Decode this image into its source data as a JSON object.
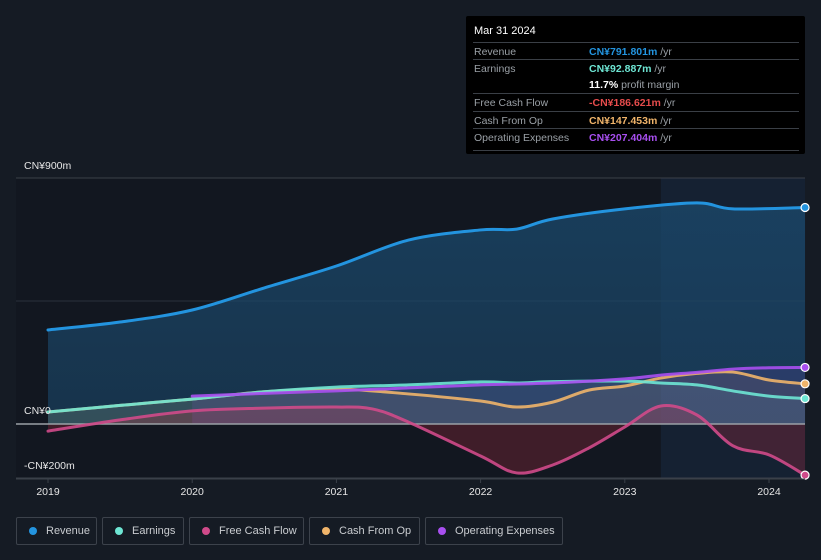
{
  "tooltip": {
    "date": "Mar 31 2024",
    "rows": [
      {
        "label": "Revenue",
        "value": "CN¥791.801m",
        "unit": " /yr",
        "color": "#2394df"
      },
      {
        "label": "Earnings",
        "value": "CN¥92.887m",
        "unit": " /yr",
        "color": "#6ee6d4"
      },
      {
        "label": "",
        "value": "11.7%",
        "unit": " profit margin",
        "color": "#ffffff"
      },
      {
        "label": "Free Cash Flow",
        "value": "-CN¥186.621m",
        "unit": " /yr",
        "color": "#e64c4c"
      },
      {
        "label": "Cash From Op",
        "value": "CN¥147.453m",
        "unit": " /yr",
        "color": "#f0b46a"
      },
      {
        "label": "Operating Expenses",
        "value": "CN¥207.404m",
        "unit": " /yr",
        "color": "#a84ff0"
      }
    ]
  },
  "legend": [
    {
      "label": "Revenue",
      "color": "#2394df"
    },
    {
      "label": "Earnings",
      "color": "#6ee6d4"
    },
    {
      "label": "Free Cash Flow",
      "color": "#d04a8a"
    },
    {
      "label": "Cash From Op",
      "color": "#f0b46a"
    },
    {
      "label": "Operating Expenses",
      "color": "#a84ff0"
    }
  ],
  "chart_data": {
    "type": "area",
    "title": "",
    "xlabel": "",
    "ylabel": "",
    "ylim": [
      -200,
      900
    ],
    "xlim": [
      2018.78,
      2024.25
    ],
    "y_tick_labels": [
      {
        "value": 900,
        "label": "CN¥900m"
      },
      {
        "value": 0,
        "label": "CN¥0"
      },
      {
        "value": -200,
        "label": "-CN¥200m"
      }
    ],
    "x_ticks": [
      2019,
      2020,
      2021,
      2022,
      2023,
      2024
    ],
    "x_tick_labels": [
      "2019",
      "2020",
      "2021",
      "2022",
      "2023",
      "2024"
    ],
    "grid": true,
    "highlight_from": 2023.25,
    "legend_position": "bottom-left",
    "series": [
      {
        "name": "Revenue",
        "color": "#2394df",
        "x": [
          2019,
          2019.5,
          2020,
          2020.5,
          2021,
          2021.5,
          2022,
          2022.25,
          2022.5,
          2023,
          2023.5,
          2023.75,
          2024.25
        ],
        "values": [
          344,
          373,
          417,
          498,
          578,
          673,
          710,
          713,
          750,
          787,
          809,
          787,
          792
        ]
      },
      {
        "name": "Earnings",
        "color": "#6ee6d4",
        "x": [
          2019,
          2019.5,
          2020,
          2020.5,
          2021,
          2021.5,
          2022,
          2022.25,
          2022.5,
          2023,
          2023.25,
          2023.5,
          2023.75,
          2024,
          2024.25
        ],
        "values": [
          44,
          68,
          91,
          118,
          135,
          143,
          154,
          150,
          155,
          157,
          150,
          143,
          121,
          102,
          93
        ]
      },
      {
        "name": "Free Cash Flow",
        "color": "#d04a8a",
        "x": [
          2019,
          2019.5,
          2020,
          2020.5,
          2021,
          2021.25,
          2021.5,
          2022,
          2022.25,
          2022.5,
          2022.75,
          2023,
          2023.25,
          2023.5,
          2023.75,
          2024,
          2024.25
        ],
        "values": [
          -26,
          15,
          48,
          58,
          62,
          55,
          7,
          -117,
          -179,
          -150,
          -88,
          -11,
          66,
          33,
          -80,
          -113,
          -187
        ]
      },
      {
        "name": "Cash From Op",
        "color": "#f0b46a",
        "x": [
          2019,
          2019.5,
          2020,
          2020.5,
          2021,
          2021.5,
          2022,
          2022.25,
          2022.5,
          2022.75,
          2023,
          2023.25,
          2023.5,
          2023.75,
          2024,
          2024.25
        ],
        "values": [
          44,
          68,
          91,
          118,
          128,
          110,
          84,
          62,
          80,
          124,
          139,
          168,
          185,
          190,
          161,
          147
        ]
      },
      {
        "name": "Operating Expenses",
        "color": "#a84ff0",
        "x": [
          2020,
          2020.5,
          2021,
          2021.5,
          2022,
          2022.5,
          2023,
          2023.25,
          2023.5,
          2023.75,
          2024,
          2024.25
        ],
        "values": [
          102,
          112,
          121,
          132,
          143,
          150,
          165,
          179,
          189,
          201,
          206,
          207
        ]
      }
    ]
  }
}
